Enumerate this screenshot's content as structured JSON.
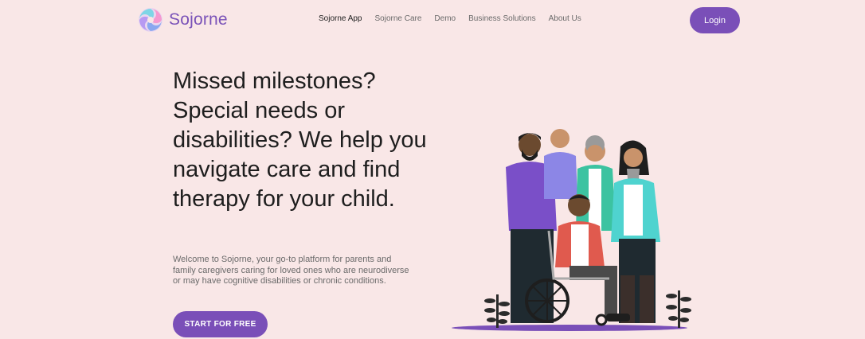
{
  "brand": {
    "name": "Sojorne"
  },
  "nav": {
    "items": [
      {
        "label": "Sojorne App",
        "active": true
      },
      {
        "label": "Sojorne Care",
        "active": false
      },
      {
        "label": "Demo",
        "active": false
      },
      {
        "label": "Business Solutions",
        "active": false
      },
      {
        "label": "About Us",
        "active": false
      }
    ],
    "login_label": "Login"
  },
  "hero": {
    "headline": "Missed milestones? Special needs or disabilities? We help you navigate care and find therapy for your child.",
    "intro": "Welcome to Sojorne, your go-to platform for parents and family caregivers caring for loved ones who are neurodiverse or may have cognitive disabilities or chronic conditions.",
    "cta_label": "START FOR FREE",
    "illustration_icon": "family-with-wheelchair-illustration"
  },
  "colors": {
    "background": "#f9e7e7",
    "accent": "#7a4fb8",
    "text": "#1e1e1e",
    "muted_text": "#6a6a6a"
  }
}
